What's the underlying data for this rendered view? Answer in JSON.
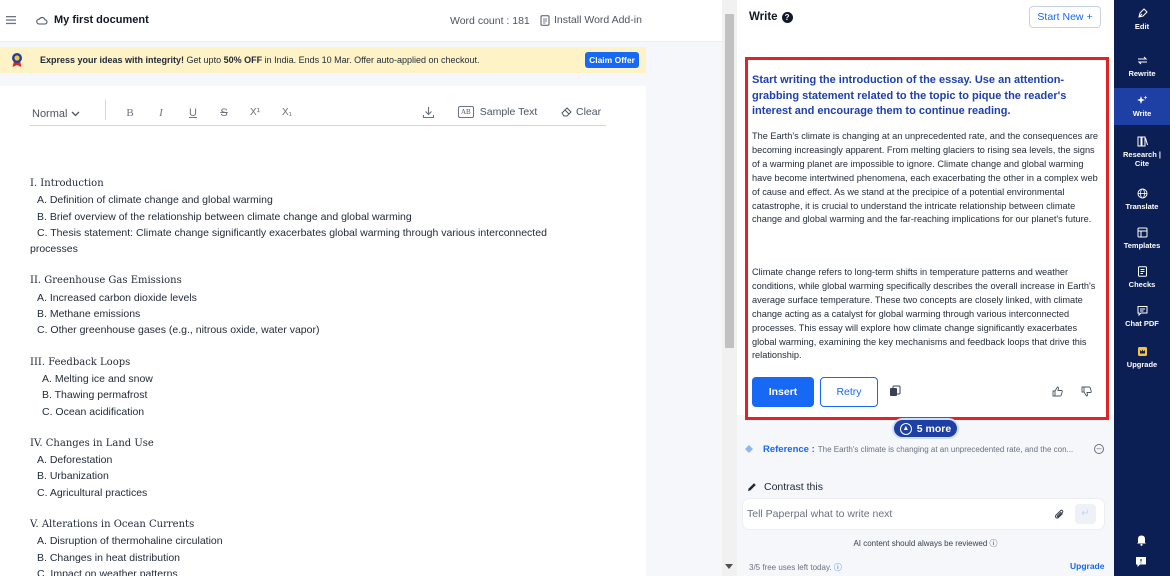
{
  "topbar": {
    "doc_title": "My first document",
    "word_count": "Word count : 181",
    "install_addin": "Install Word Add-in"
  },
  "promo": {
    "lead": "Express your ideas with integrity!",
    "mid": " Get upto ",
    "discount": "50% OFF",
    "tail": " in India. Ends 10 Mar. Offer auto-applied on checkout.",
    "claim_label": "Claim Offer"
  },
  "toolbar": {
    "style": "Normal",
    "bold": "B",
    "italic": "I",
    "underline": "U",
    "strike": "S",
    "superscript": "X¹",
    "subscript": "X₁",
    "sample_ab": "AB",
    "sample_text": "Sample Text",
    "clear": "Clear"
  },
  "outline": [
    {
      "title": "I. Introduction",
      "items": [
        "A. Definition of climate change and global warming",
        "B. Brief overview of the relationship between climate change and global warming",
        "C. Thesis statement: Climate change significantly exacerbates global warming through various interconnected processes"
      ]
    },
    {
      "title": "II. Greenhouse Gas Emissions",
      "items": [
        "A. Increased carbon dioxide levels",
        "B. Methane emissions",
        "C. Other greenhouse gases (e.g., nitrous oxide, water vapor)"
      ]
    },
    {
      "title": "III. Feedback Loops",
      "items": [
        "A. Melting ice and snow",
        "B. Thawing permafrost",
        "C. Ocean acidification"
      ]
    },
    {
      "title": "IV. Changes in Land Use",
      "items": [
        "A. Deforestation",
        "B. Urbanization",
        "C. Agricultural practices"
      ]
    },
    {
      "title": "V. Alterations in Ocean Currents",
      "items": [
        "A. Disruption of thermohaline circulation",
        "B. Changes in heat distribution",
        "C. Impact on weather patterns"
      ]
    }
  ],
  "write_panel": {
    "title": "Write",
    "start_new": "Start New",
    "prompt": "Start writing the introduction of the essay. Use an attention-grabbing statement related to the topic to pique the reader's interest and encourage them to continue reading.",
    "paragraph1": "The Earth's climate is changing at an unprecedented rate, and the consequences are becoming increasingly apparent. From melting glaciers to rising sea levels, the signs of a warming planet are impossible to ignore. Climate change and global warming have become intertwined phenomena, each exacerbating the other in a complex web of cause and effect. As we stand at the precipice of a potential environmental catastrophe, it is crucial to understand the intricate relationship between climate change and global warming and the far-reaching implications for our planet's future.",
    "paragraph2": "Climate change refers to long-term shifts in temperature patterns and weather conditions, while global warming specifically describes the overall increase in Earth's average surface temperature. These two concepts are closely linked, with climate change acting as a catalyst for global warming through various interconnected processes. This essay will explore how climate change significantly exacerbates global warming, examining the key mechanisms and feedback loops that drive this relationship.",
    "insert": "Insert",
    "retry": "Retry",
    "more": "5 more",
    "reference_label": "Reference :",
    "reference_text": "The Earth's climate is changing at an unprecedented rate, and the con...",
    "contrast": "Contrast this",
    "input_placeholder": "Tell Paperpal what to write next",
    "ai_note": "AI content should always be reviewed",
    "uses_left": "3/5 free uses left today.",
    "upgrade": "Upgrade"
  },
  "nav": {
    "items": [
      {
        "label": "Edit",
        "icon": "pen-nib-icon"
      },
      {
        "label": "Rewrite",
        "icon": "rewrite-arrows-icon"
      },
      {
        "label": "Write",
        "icon": "sparkle-icon"
      },
      {
        "label": "Research | Cite",
        "icon": "research-book-icon"
      },
      {
        "label": "Translate",
        "icon": "globe-icon"
      },
      {
        "label": "Templates",
        "icon": "templates-icon"
      },
      {
        "label": "Checks",
        "icon": "checklist-icon"
      },
      {
        "label": "Chat PDF",
        "icon": "chat-pdf-icon"
      },
      {
        "label": "Upgrade",
        "icon": "crown-icon"
      }
    ]
  },
  "colors": {
    "accent": "#1668f5",
    "nav_bg": "#0b1f55",
    "nav_active": "#1e3fa3",
    "highlight_border": "#e02424",
    "promo_bg": "#fdf3c7"
  }
}
